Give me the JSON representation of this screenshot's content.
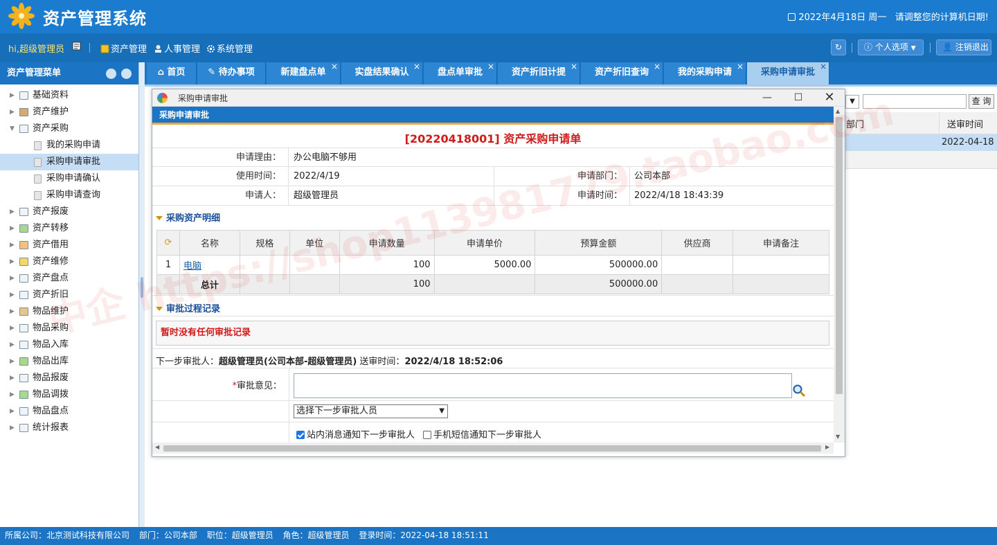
{
  "header": {
    "title": "资产管理系统",
    "date_text": "2022年4月18日 周一",
    "date_tip": "请调整您的计算机日期!"
  },
  "toolbar": {
    "greeting": "hi,超级管理员",
    "menus": [
      "资产管理",
      "人事管理",
      "系统管理"
    ],
    "personal_options": "个人选项",
    "logout": "注销退出"
  },
  "sidebar": {
    "title": "资产管理菜单",
    "items": [
      {
        "label": "基础资料",
        "expanded": false
      },
      {
        "label": "资产维护",
        "expanded": false
      },
      {
        "label": "资产采购",
        "expanded": true,
        "children": [
          {
            "label": "我的采购申请"
          },
          {
            "label": "采购申请审批",
            "active": true
          },
          {
            "label": "采购申请确认"
          },
          {
            "label": "采购申请查询"
          }
        ]
      },
      {
        "label": "资产报废"
      },
      {
        "label": "资产转移"
      },
      {
        "label": "资产借用"
      },
      {
        "label": "资产维修"
      },
      {
        "label": "资产盘点"
      },
      {
        "label": "资产折旧"
      },
      {
        "label": "物品维护"
      },
      {
        "label": "物品采购"
      },
      {
        "label": "物品入库"
      },
      {
        "label": "物品出库"
      },
      {
        "label": "物品报废"
      },
      {
        "label": "物品调拨"
      },
      {
        "label": "物品盘点"
      },
      {
        "label": "统计报表"
      }
    ]
  },
  "tabs": [
    {
      "label": "首页",
      "closable": false
    },
    {
      "label": "待办事项",
      "closable": false
    },
    {
      "label": "新建盘点单",
      "closable": true
    },
    {
      "label": "实盘结果确认",
      "closable": true
    },
    {
      "label": "盘点单审批",
      "closable": true
    },
    {
      "label": "资产折旧计提",
      "closable": true
    },
    {
      "label": "资产折旧查询",
      "closable": true
    },
    {
      "label": "我的采购申请",
      "closable": true
    },
    {
      "label": "采购申请审批",
      "closable": true,
      "active": true
    }
  ],
  "bg_grid": {
    "query_button": "查 询",
    "col_dept": "部门",
    "col_send_time": "送审时间",
    "row_send_time": "2022-04-18"
  },
  "dialog": {
    "window_title": "采购申请审批",
    "panel_title": "采购申请审批",
    "form_title": "[20220418001] 资产采购申请单",
    "fields": {
      "reason_label": "申请理由：",
      "reason": "办公电脑不够用",
      "use_time_label": "使用时间：",
      "use_time": "2022/4/19",
      "dept_label": "申请部门：",
      "dept": "公司本部",
      "applicant_label": "申请人：",
      "applicant": "超级管理员",
      "apply_time_label": "申请时间：",
      "apply_time": "2022/4/18 18:43:39"
    },
    "detail_section": "采购资产明细",
    "detail_columns": [
      "名称",
      "规格",
      "单位",
      "申请数量",
      "申请单价",
      "预算金额",
      "供应商",
      "申请备注"
    ],
    "detail_rows": [
      {
        "no": "1",
        "name": "电脑",
        "spec": "",
        "unit": "",
        "qty": "100",
        "price": "5000.00",
        "amount": "500000.00",
        "supplier": "",
        "remark": ""
      }
    ],
    "total": {
      "label": "总计",
      "qty": "100",
      "amount": "500000.00"
    },
    "history_section": "审批过程记录",
    "no_record": "暂时没有任何审批记录",
    "next_step": {
      "prefix": "下一步审批人：",
      "approver": "超级管理员(公司本部-超级管理员)",
      "time_label": " 送审时间：",
      "time": "2022/4/18 18:52:06"
    },
    "opinion_label": "审批意见：",
    "approver_select": "选择下一步审批人员",
    "notify_site": "站内消息通知下一步审批人",
    "notify_site_checked": true,
    "notify_sms": "手机短信通知下一步审批人",
    "notify_sms_checked": false
  },
  "statusbar": {
    "company": "所属公司：北京测试科技有限公司",
    "dept": "部门：公司本部",
    "position": "职位：超级管理员",
    "role": "角色：超级管理员",
    "login": "登录时间：2022-04-18 18:51:11"
  },
  "watermark": "中企 https://shop113981779.taobao.com",
  "colors": {
    "primary": "#1b74c4",
    "header": "#1b7ccf",
    "title_red": "#d01b1b",
    "accent_orange": "#f2a33a"
  }
}
